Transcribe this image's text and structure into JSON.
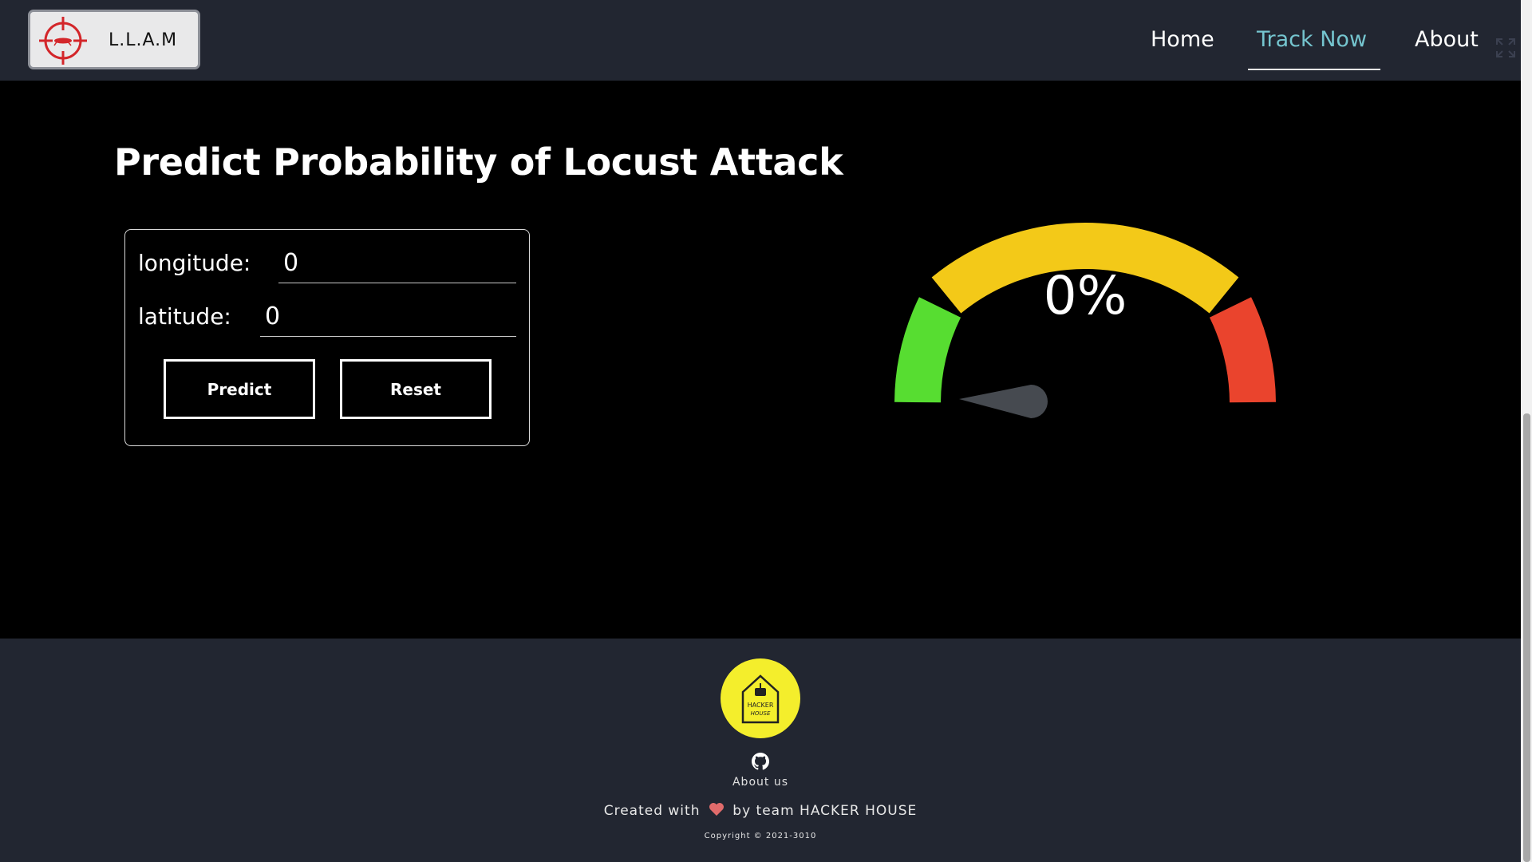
{
  "brand": {
    "name": "L.L.A.M",
    "logo_icon": "crosshair-locust-icon"
  },
  "nav": {
    "links": [
      {
        "label": "Home",
        "active": false
      },
      {
        "label": "Track Now",
        "active": true
      },
      {
        "label": "About",
        "active": false
      }
    ],
    "expand_icon": "expand-icon"
  },
  "main": {
    "title": "Predict Probability of Locust Attack",
    "form": {
      "longitude_label": "longitude:",
      "longitude_value": "0",
      "latitude_label": "latitude:",
      "latitude_value": "0",
      "predict_label": "Predict",
      "reset_label": "Reset"
    },
    "gauge": {
      "value_text": "0%",
      "value": 0,
      "colors": {
        "low": "#57dd31",
        "mid": "#f3c918",
        "high": "#ea442d",
        "needle": "#464a50"
      }
    }
  },
  "footer": {
    "logo_text_top": "HACKER",
    "logo_text_bottom": "HOUSE",
    "github_icon": "github-icon",
    "about_us": "About us",
    "created_prefix": "Created with",
    "created_suffix": "by team HACKER HOUSE",
    "copyright": "Copyright © 2021-3010"
  },
  "colors": {
    "navbar_bg": "#222631",
    "accent": "#75c5cf",
    "page_bg": "#000000",
    "footer_logo_bg": "#f4ee2c"
  }
}
